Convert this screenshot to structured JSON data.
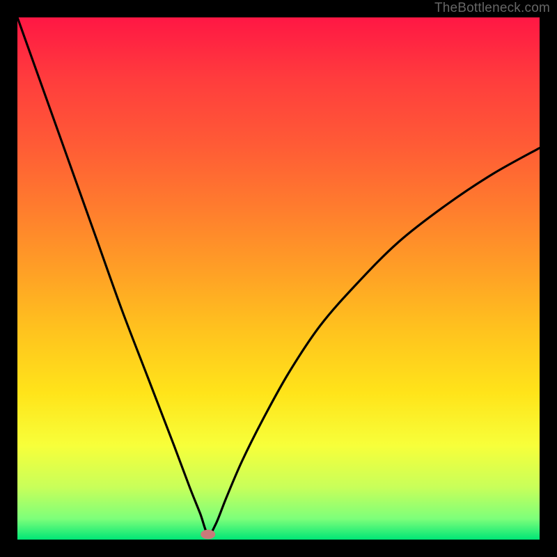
{
  "watermark": "TheBottleneck.com",
  "chart_data": {
    "type": "line",
    "title": "",
    "xlabel": "",
    "ylabel": "",
    "xlim": [
      0,
      100
    ],
    "ylim": [
      0,
      100
    ],
    "background_gradient": {
      "top_color": "#ff1744",
      "mid_color": "#ffe41a",
      "bottom_color": "#00e676",
      "meaning": "red=high bottleneck, green=no bottleneck"
    },
    "series": [
      {
        "name": "bottleneck-curve",
        "x": [
          0,
          5,
          10,
          15,
          20,
          25,
          30,
          33,
          35,
          36.5,
          38,
          40,
          43,
          47,
          52,
          58,
          65,
          73,
          82,
          91,
          100
        ],
        "values": [
          100,
          86,
          72,
          58,
          44,
          31,
          18,
          10,
          5,
          1,
          3,
          8,
          15,
          23,
          32,
          41,
          49,
          57,
          64,
          70,
          75
        ]
      }
    ],
    "marker": {
      "name": "optimal-point",
      "x": 36.5,
      "y": 1,
      "rx_percent": 1.4,
      "ry_percent": 0.9,
      "color": "#c97a7a"
    }
  }
}
